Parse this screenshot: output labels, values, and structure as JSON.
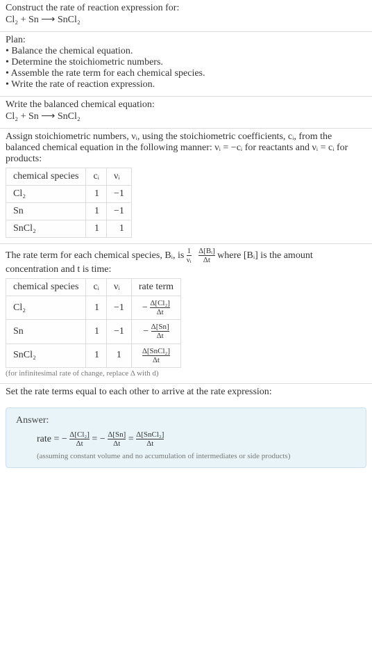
{
  "s1": {
    "title": "Construct the rate of reaction expression for:",
    "equation": "Cl₂ + Sn ⟶ SnCl₂"
  },
  "s2": {
    "label": "Plan:",
    "b1": "• Balance the chemical equation.",
    "b2": "• Determine the stoichiometric numbers.",
    "b3": "• Assemble the rate term for each chemical species.",
    "b4": "• Write the rate of reaction expression."
  },
  "s3": {
    "title": "Write the balanced chemical equation:",
    "equation": "Cl₂ + Sn ⟶ SnCl₂"
  },
  "s4": {
    "text": "Assign stoichiometric numbers, νᵢ, using the stoichiometric coefficients, cᵢ, from the balanced chemical equation in the following manner: νᵢ = −cᵢ for reactants and νᵢ = cᵢ for products:",
    "h1": "chemical species",
    "h2": "cᵢ",
    "h3": "νᵢ",
    "r1c1": "Cl₂",
    "r1c2": "1",
    "r1c3": "−1",
    "r2c1": "Sn",
    "r2c2": "1",
    "r2c3": "−1",
    "r3c1": "SnCl₂",
    "r3c2": "1",
    "r3c3": "1"
  },
  "s5": {
    "textA": "The rate term for each chemical species, Bᵢ, is ",
    "fracTop": "1",
    "fracBot": "νᵢ",
    "fracTop2": "Δ[Bᵢ]",
    "fracBot2": "Δt",
    "textB": " where [Bᵢ] is the amount concentration and t is time:",
    "h1": "chemical species",
    "h2": "cᵢ",
    "h3": "νᵢ",
    "h4": "rate term",
    "r1c1": "Cl₂",
    "r1c2": "1",
    "r1c3": "−1",
    "r2c1": "Sn",
    "r2c2": "1",
    "r2c3": "−1",
    "r3c1": "SnCl₂",
    "r3c2": "1",
    "r3c3": "1",
    "rt1top": "Δ[Cl₂]",
    "rt1bot": "Δt",
    "rt1sign": "−",
    "rt2top": "Δ[Sn]",
    "rt2bot": "Δt",
    "rt2sign": "−",
    "rt3top": "Δ[SnCl₂]",
    "rt3bot": "Δt",
    "rt3sign": "",
    "foot": "(for infinitesimal rate of change, replace Δ with d)"
  },
  "s6": {
    "text": "Set the rate terms equal to each other to arrive at the rate expression:"
  },
  "answer": {
    "label": "Answer:",
    "prefix": "rate = −",
    "f1top": "Δ[Cl₂]",
    "f1bot": "Δt",
    "mid1": " = −",
    "f2top": "Δ[Sn]",
    "f2bot": "Δt",
    "mid2": " = ",
    "f3top": "Δ[SnCl₂]",
    "f3bot": "Δt",
    "note": "(assuming constant volume and no accumulation of intermediates or side products)"
  },
  "chart_data": {
    "type": "table",
    "title": "Stoichiometric numbers and rate terms",
    "columns": [
      "chemical species",
      "c_i",
      "ν_i",
      "rate term"
    ],
    "rows": [
      {
        "species": "Cl2",
        "c_i": 1,
        "nu_i": -1,
        "rate_term": "-(Δ[Cl2]/Δt)"
      },
      {
        "species": "Sn",
        "c_i": 1,
        "nu_i": -1,
        "rate_term": "-(Δ[Sn]/Δt)"
      },
      {
        "species": "SnCl2",
        "c_i": 1,
        "nu_i": 1,
        "rate_term": "(Δ[SnCl2]/Δt)"
      }
    ],
    "rate_expression": "rate = -Δ[Cl2]/Δt = -Δ[Sn]/Δt = Δ[SnCl2]/Δt"
  }
}
